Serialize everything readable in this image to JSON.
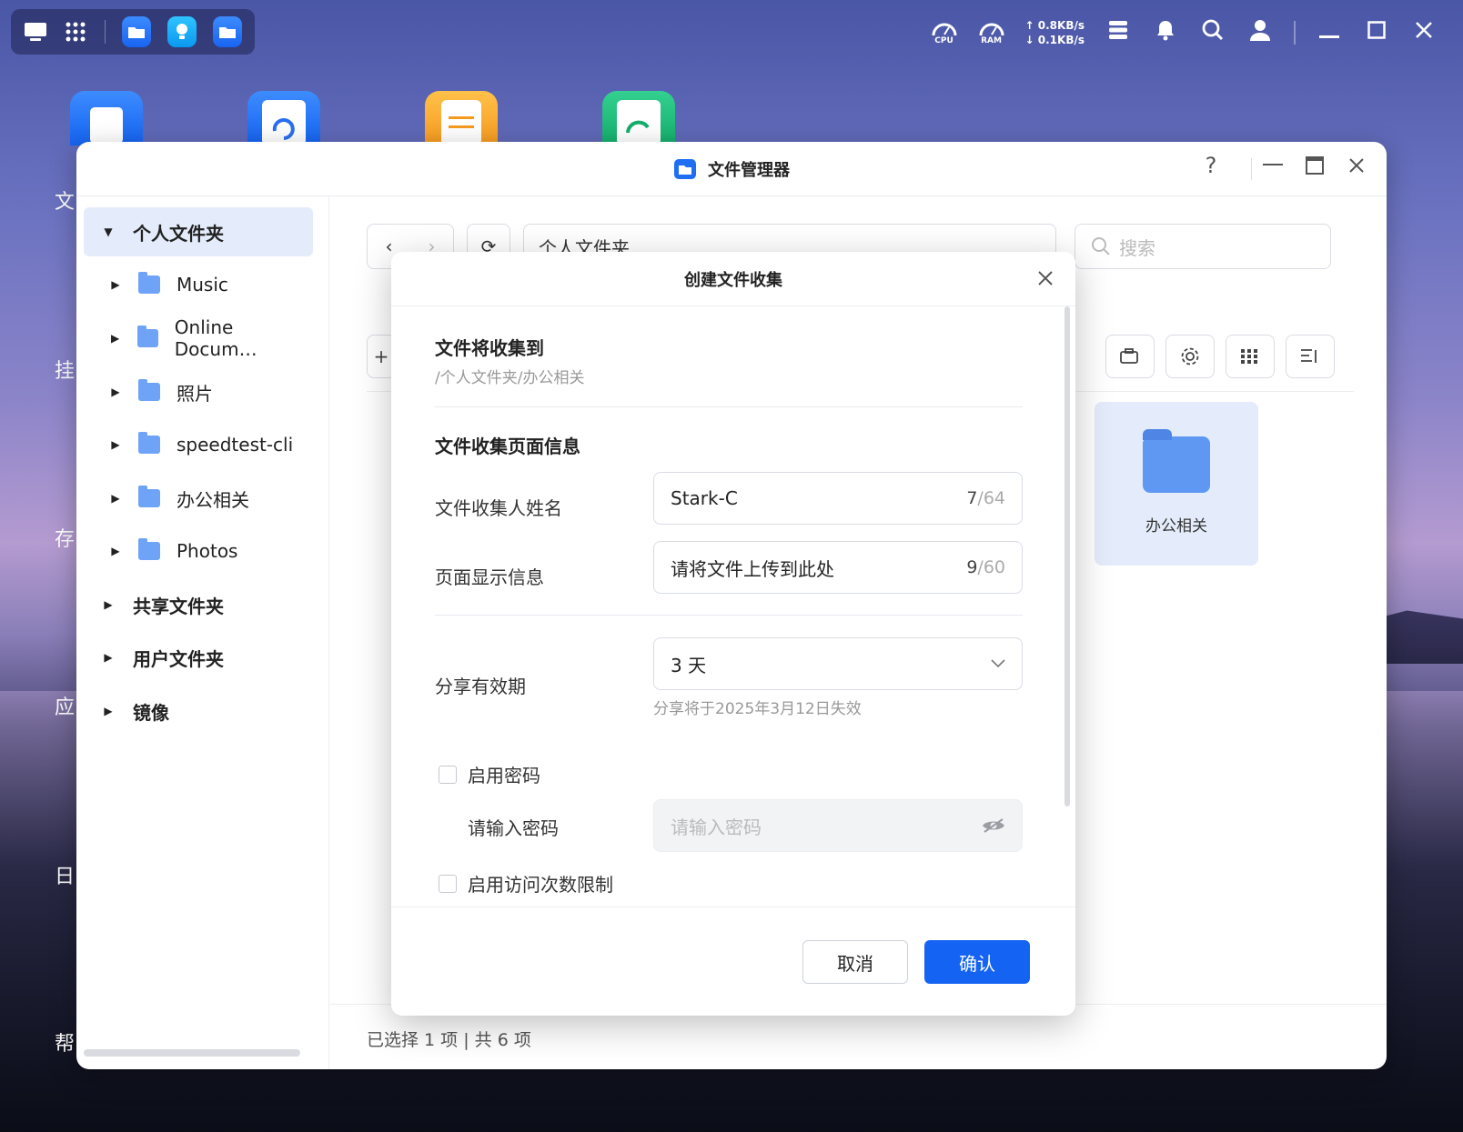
{
  "taskbar": {
    "cpu_label": "CPU",
    "ram_label": "RAM",
    "net_up": "↑ 0.8KB/s",
    "net_down": "↓ 0.1KB/s"
  },
  "desktop": {
    "side_labels": [
      "文",
      "挂",
      "存",
      "应",
      "日",
      "帮"
    ]
  },
  "window": {
    "title": "文件管理器",
    "help": "?"
  },
  "sidebar": {
    "items": [
      {
        "label": "个人文件夹",
        "bold": true,
        "expanded": true
      },
      {
        "label": "Music"
      },
      {
        "label": "Online Docum…"
      },
      {
        "label": "照片"
      },
      {
        "label": "speedtest-cli"
      },
      {
        "label": "办公相关"
      },
      {
        "label": "Photos"
      },
      {
        "label": "共享文件夹",
        "bold": true
      },
      {
        "label": "用户文件夹",
        "bold": true
      },
      {
        "label": "镜像",
        "bold": true
      }
    ]
  },
  "toolbar": {
    "path": "个人文件夹",
    "search_placeholder": "搜索",
    "new_button": "+"
  },
  "files": [
    {
      "name": "办公相关",
      "selected": true
    }
  ],
  "status": {
    "text": "已选择 1 项 | 共 6 项"
  },
  "modal": {
    "title": "创建文件收集",
    "dest_title": "文件将收集到",
    "dest_path": "/个人文件夹/办公相关",
    "info_title": "文件收集页面信息",
    "collector_label": "文件收集人姓名",
    "collector_value": "Stark-C",
    "collector_count": "7",
    "collector_max": "/64",
    "message_label": "页面显示信息",
    "message_value": "请将文件上传到此处",
    "message_count": "9",
    "message_max": "/60",
    "expiry_label": "分享有效期",
    "expiry_value": "3 天",
    "expiry_hint": "分享将于2025年3月12日失效",
    "password_toggle": "启用密码",
    "password_label": "请输入密码",
    "password_placeholder": "请输入密码",
    "visit_limit_toggle": "启用访问次数限制",
    "cancel": "取消",
    "confirm": "确认"
  },
  "colors": {
    "primary": "#1463f3",
    "selected_bg": "#e4ecfb",
    "folder": "#5e98f3"
  }
}
